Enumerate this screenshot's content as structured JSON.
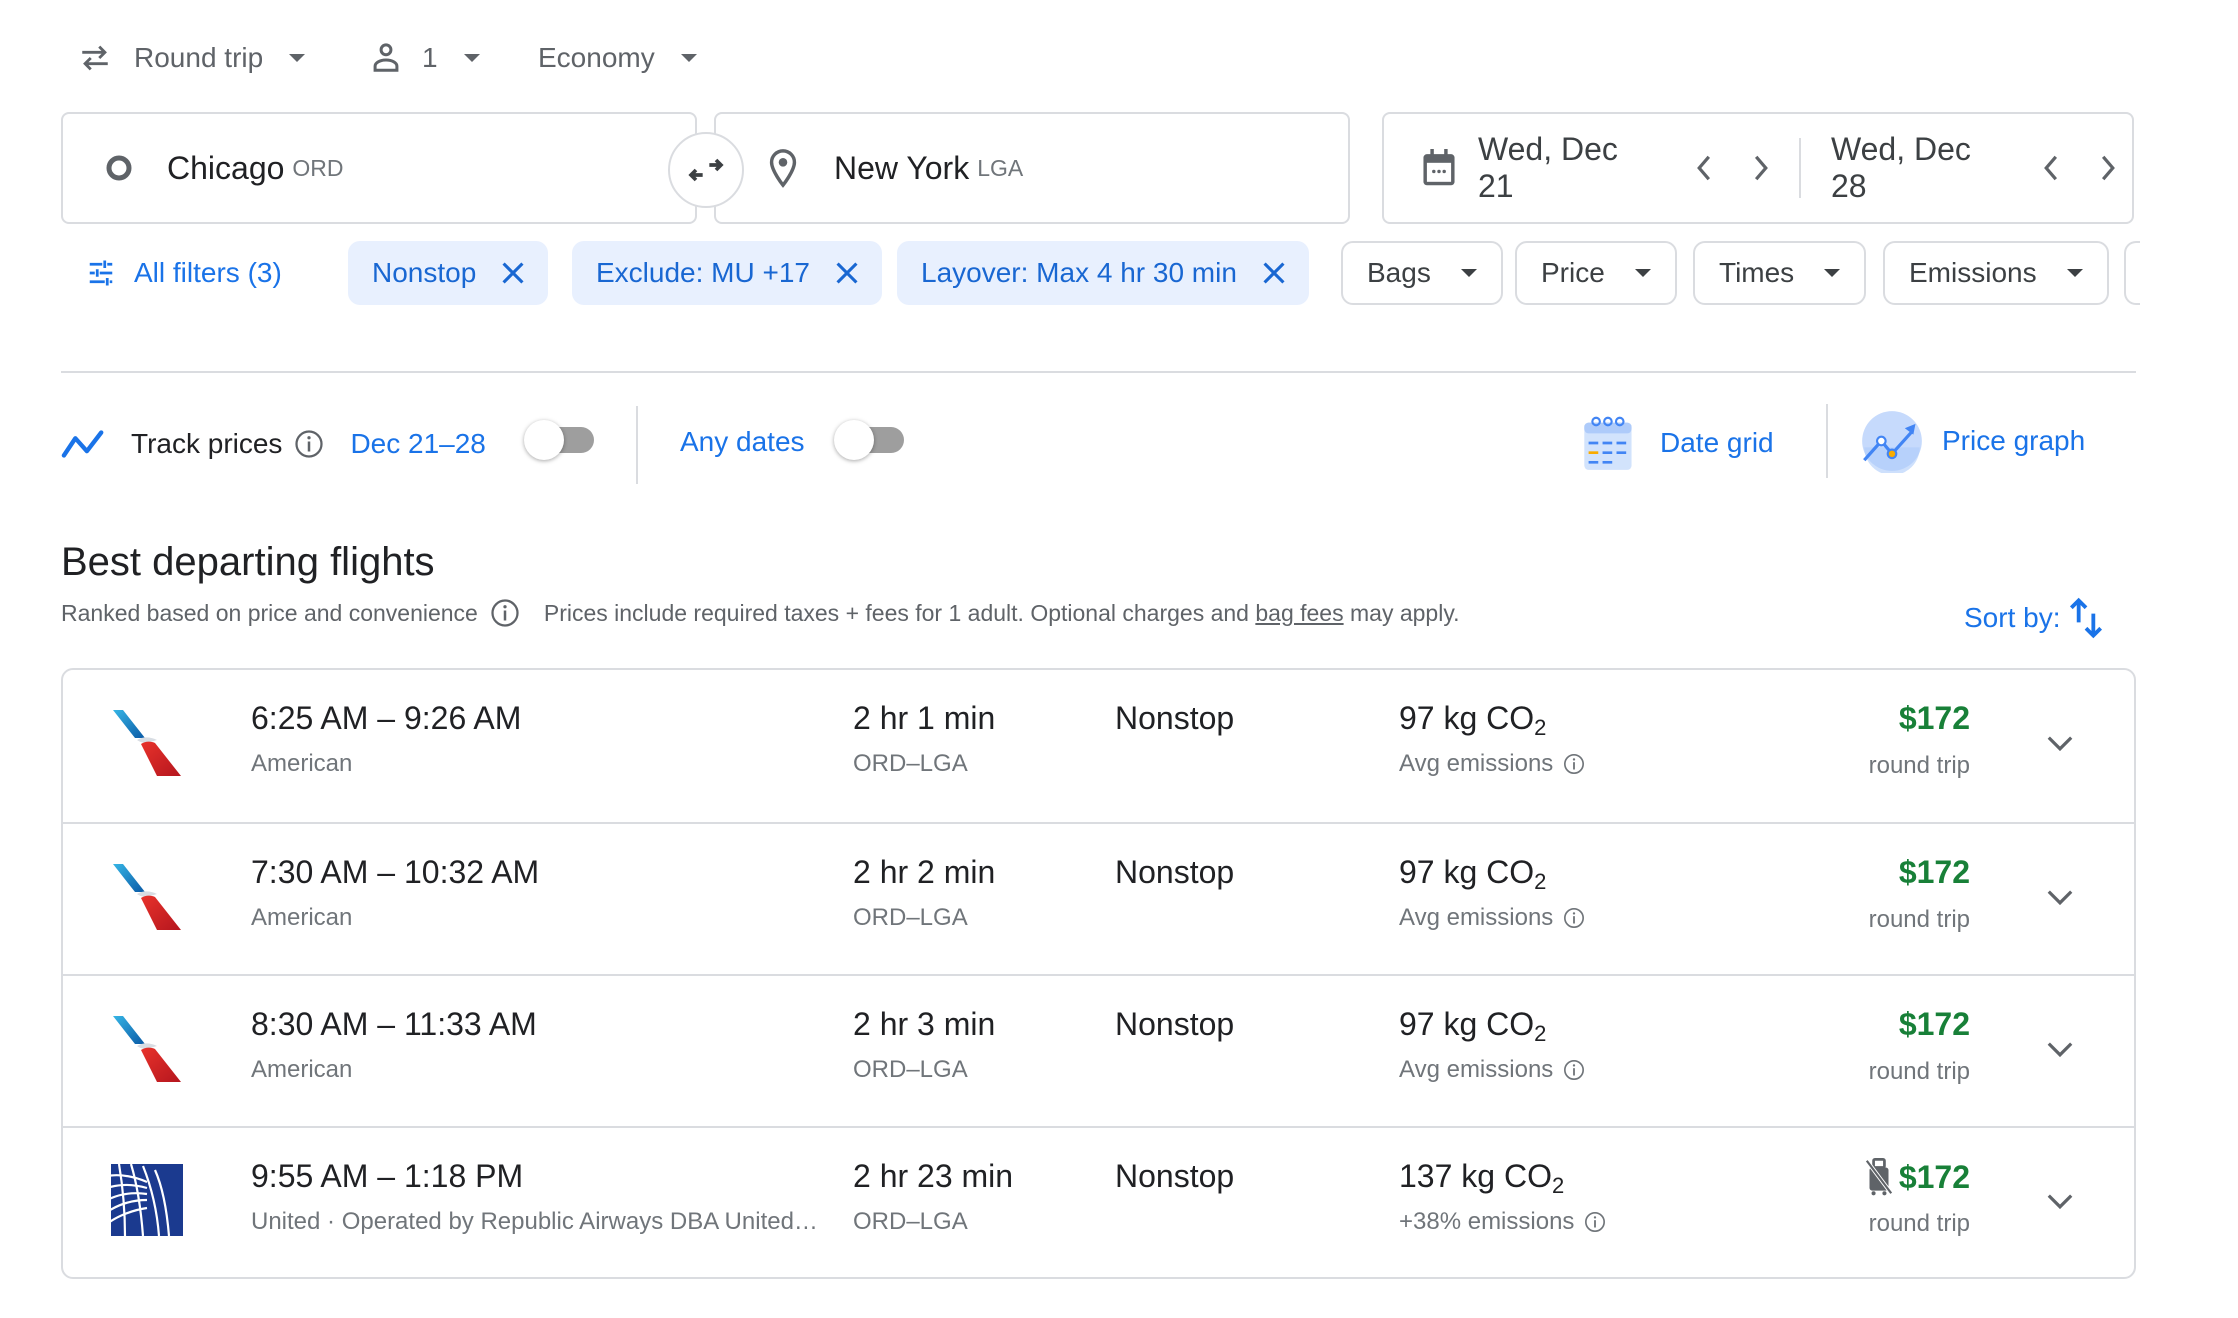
{
  "trip_options": {
    "trip_type": "Round trip",
    "passengers": "1",
    "cabin_class": "Economy"
  },
  "search": {
    "origin_city": "Chicago",
    "origin_code": "ORD",
    "destination_city": "New York",
    "destination_code": "LGA",
    "depart_date": "Wed, Dec 21",
    "return_date": "Wed, Dec 28"
  },
  "filters": {
    "all_filters_label": "All filters (3)",
    "active": [
      {
        "label": "Nonstop"
      },
      {
        "label": "Exclude: MU +17"
      },
      {
        "label": "Layover: Max 4 hr 30 min"
      }
    ],
    "dropdowns": [
      {
        "label": "Bags"
      },
      {
        "label": "Price"
      },
      {
        "label": "Times"
      },
      {
        "label": "Emissions"
      }
    ]
  },
  "tracking": {
    "track_label": "Track prices",
    "date_range": "Dec 21–28",
    "date_range_tracked": false,
    "any_dates_label": "Any dates",
    "any_dates_tracked": false,
    "date_grid_label": "Date grid",
    "price_graph_label": "Price graph"
  },
  "results": {
    "heading": "Best departing flights",
    "ranking_note": "Ranked based on price and convenience",
    "price_note_prefix": "Prices include required taxes + fees for 1 adult. Optional charges and ",
    "bag_fees_link": "bag fees",
    "price_note_suffix": " may apply.",
    "sort_label": "Sort by:",
    "flights": [
      {
        "airline_logo": "american-airlines",
        "times": "6:25 AM – 9:26 AM",
        "airline": "American",
        "duration": "2 hr 1 min",
        "route": "ORD–LGA",
        "stops": "Nonstop",
        "co2_value": "97 kg CO",
        "co2_sub": "2",
        "emissions_note": "Avg emissions",
        "no_carry_on": false,
        "price": "$172",
        "price_type": "round trip"
      },
      {
        "airline_logo": "american-airlines",
        "times": "7:30 AM – 10:32 AM",
        "airline": "American",
        "duration": "2 hr 2 min",
        "route": "ORD–LGA",
        "stops": "Nonstop",
        "co2_value": "97 kg CO",
        "co2_sub": "2",
        "emissions_note": "Avg emissions",
        "no_carry_on": false,
        "price": "$172",
        "price_type": "round trip"
      },
      {
        "airline_logo": "american-airlines",
        "times": "8:30 AM – 11:33 AM",
        "airline": "American",
        "duration": "2 hr 3 min",
        "route": "ORD–LGA",
        "stops": "Nonstop",
        "co2_value": "97 kg CO",
        "co2_sub": "2",
        "emissions_note": "Avg emissions",
        "no_carry_on": false,
        "price": "$172",
        "price_type": "round trip"
      },
      {
        "airline_logo": "united-airlines",
        "times": "9:55 AM – 1:18 PM",
        "airline": "United · Operated by Republic Airways DBA United…",
        "duration": "2 hr 23 min",
        "route": "ORD–LGA",
        "stops": "Nonstop",
        "co2_value": "137 kg CO",
        "co2_sub": "2",
        "emissions_note": "+38% emissions",
        "no_carry_on": true,
        "price": "$172",
        "price_type": "round trip"
      }
    ]
  },
  "colors": {
    "accent_blue": "#1a73e8",
    "chip_active_bg": "#e8f0fe",
    "price_green": "#188038",
    "border_gray": "#dadce0"
  }
}
